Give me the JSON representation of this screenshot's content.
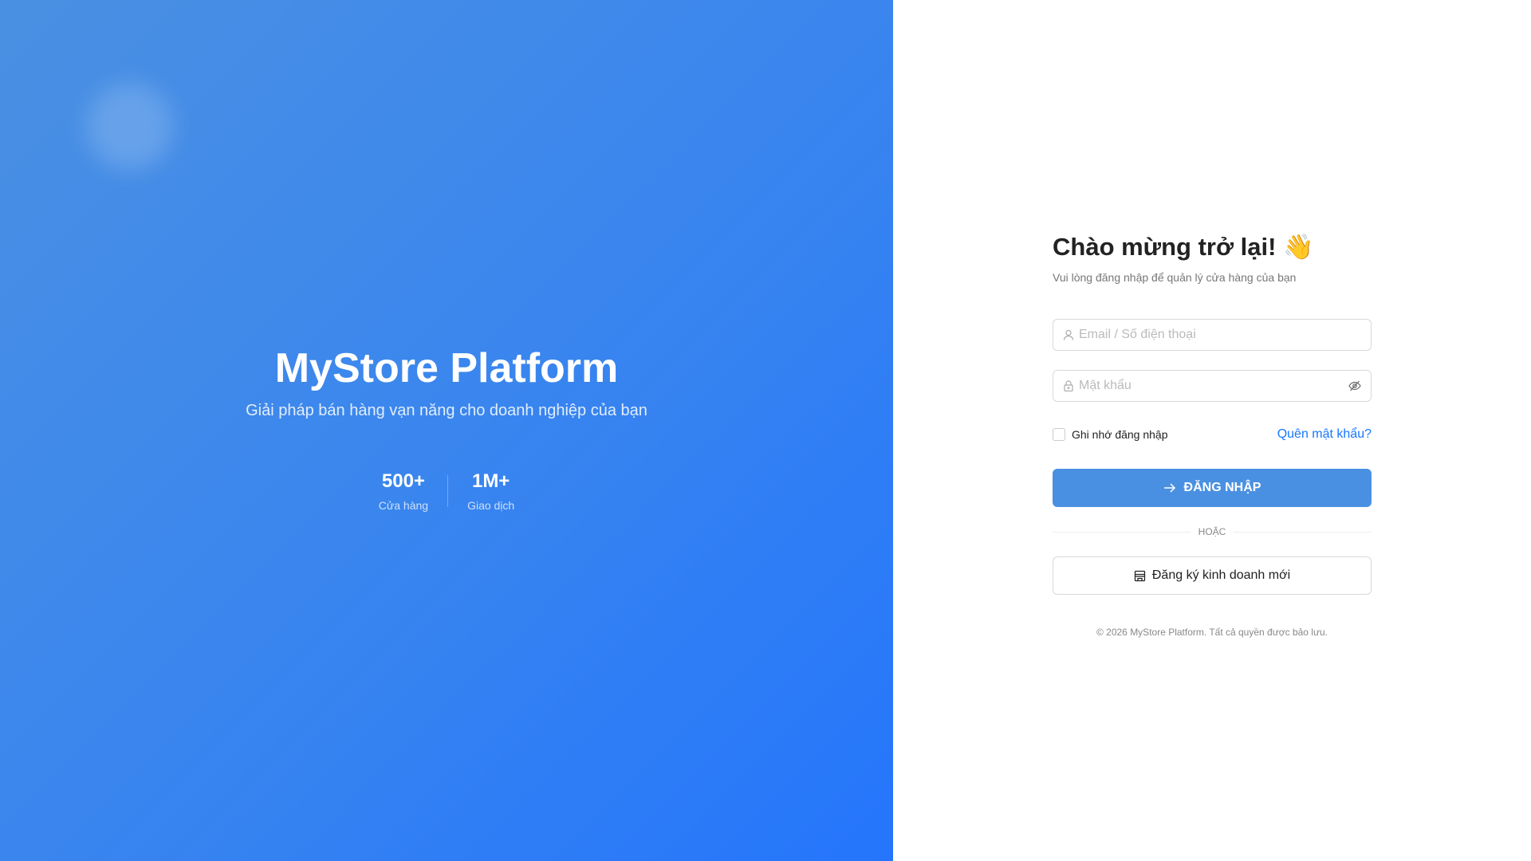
{
  "hero": {
    "title": "MyStore Platform",
    "tagline": "Giải pháp bán hàng vạn năng cho doanh nghiệp của bạn",
    "stats": [
      {
        "value": "500+",
        "label": "Cửa hàng"
      },
      {
        "value": "1M+",
        "label": "Giao dịch"
      }
    ]
  },
  "login": {
    "title": "Chào mừng trở lại! 👋",
    "subtitle": "Vui lòng đăng nhập để quản lý cửa hàng của bạn",
    "email_placeholder": "Email / Số điện thoại",
    "password_placeholder": "Mật khẩu",
    "remember": "Ghi nhớ đăng nhập",
    "forgot": "Quên mật khẩu?",
    "submit": "ĐĂNG NHẬP",
    "or": "HOẶC",
    "register": "Đăng ký kinh doanh mới",
    "footer": "© 2026 MyStore Platform. Tất cả quyền được bảo lưu."
  },
  "colors": {
    "primary": "#4a90e2",
    "link": "#1677ff",
    "gradient_end": "#2575fc"
  }
}
